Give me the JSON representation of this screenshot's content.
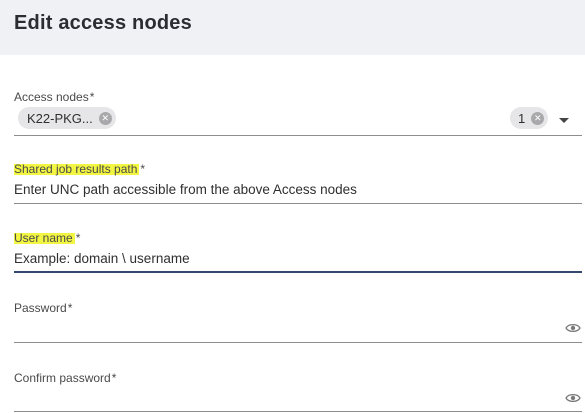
{
  "dialog": {
    "title": "Edit access nodes"
  },
  "fields": {
    "access_nodes": {
      "label": "Access nodes",
      "required": "*",
      "chip_label": "K22-PKG...",
      "count_label": "1"
    },
    "shared_path": {
      "label": "Shared job results path",
      "required": "*",
      "placeholder": "Enter UNC path accessible from the above Access nodes"
    },
    "user_name": {
      "label": "User name",
      "required": "*",
      "placeholder": "Example: domain \\ username"
    },
    "password": {
      "label": "Password",
      "required": "*",
      "placeholder": ""
    },
    "confirm_password": {
      "label": "Confirm password",
      "required": "*",
      "placeholder": ""
    }
  },
  "colors": {
    "header_bg": "#f0f1f5",
    "highlight": "#f2f542",
    "focus_underline": "#334a6e"
  },
  "icons": {
    "chip_remove": "x-circle-icon",
    "dropdown": "caret-down-icon",
    "show_password": "eye-icon"
  }
}
